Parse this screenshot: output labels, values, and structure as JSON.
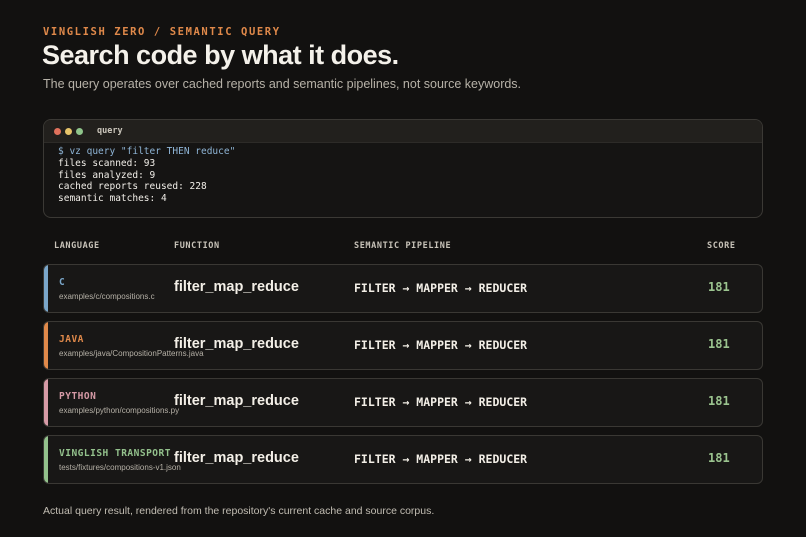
{
  "header": {
    "eyebrow": "VINGLISH ZERO / SEMANTIC QUERY",
    "title": "Search code by what it does.",
    "subtitle": "The query operates over cached reports and semantic pipelines, not source keywords."
  },
  "terminal": {
    "title": "query",
    "command": "$ vz query \"filter THEN reduce\"",
    "lines": [
      "files scanned: 93",
      "files analyzed: 9",
      "cached reports reused: 228",
      "semantic matches: 4"
    ]
  },
  "table": {
    "columns": [
      "LANGUAGE",
      "FUNCTION",
      "SEMANTIC PIPELINE",
      "SCORE"
    ],
    "rows": [
      {
        "language": "C",
        "path": "examples/c/compositions.c",
        "function": "filter_map_reduce",
        "pipeline": "FILTER → MAPPER → REDUCER",
        "score": "181",
        "accent": "#7aa6c9"
      },
      {
        "language": "JAVA",
        "path": "examples/java/CompositionPatterns.java",
        "function": "filter_map_reduce",
        "pipeline": "FILTER → MAPPER → REDUCER",
        "score": "181",
        "accent": "#e0894a"
      },
      {
        "language": "PYTHON",
        "path": "examples/python/compositions.py",
        "function": "filter_map_reduce",
        "pipeline": "FILTER → MAPPER → REDUCER",
        "score": "181",
        "accent": "#d69aa6"
      },
      {
        "language": "VINGLISH TRANSPORT",
        "path": "tests/fixtures/compositions-v1.json",
        "function": "filter_map_reduce",
        "pipeline": "FILTER → MAPPER → REDUCER",
        "score": "181",
        "accent": "#93c18c"
      }
    ]
  },
  "footer": "Actual query result, rendered from the repository's current cache and source corpus."
}
